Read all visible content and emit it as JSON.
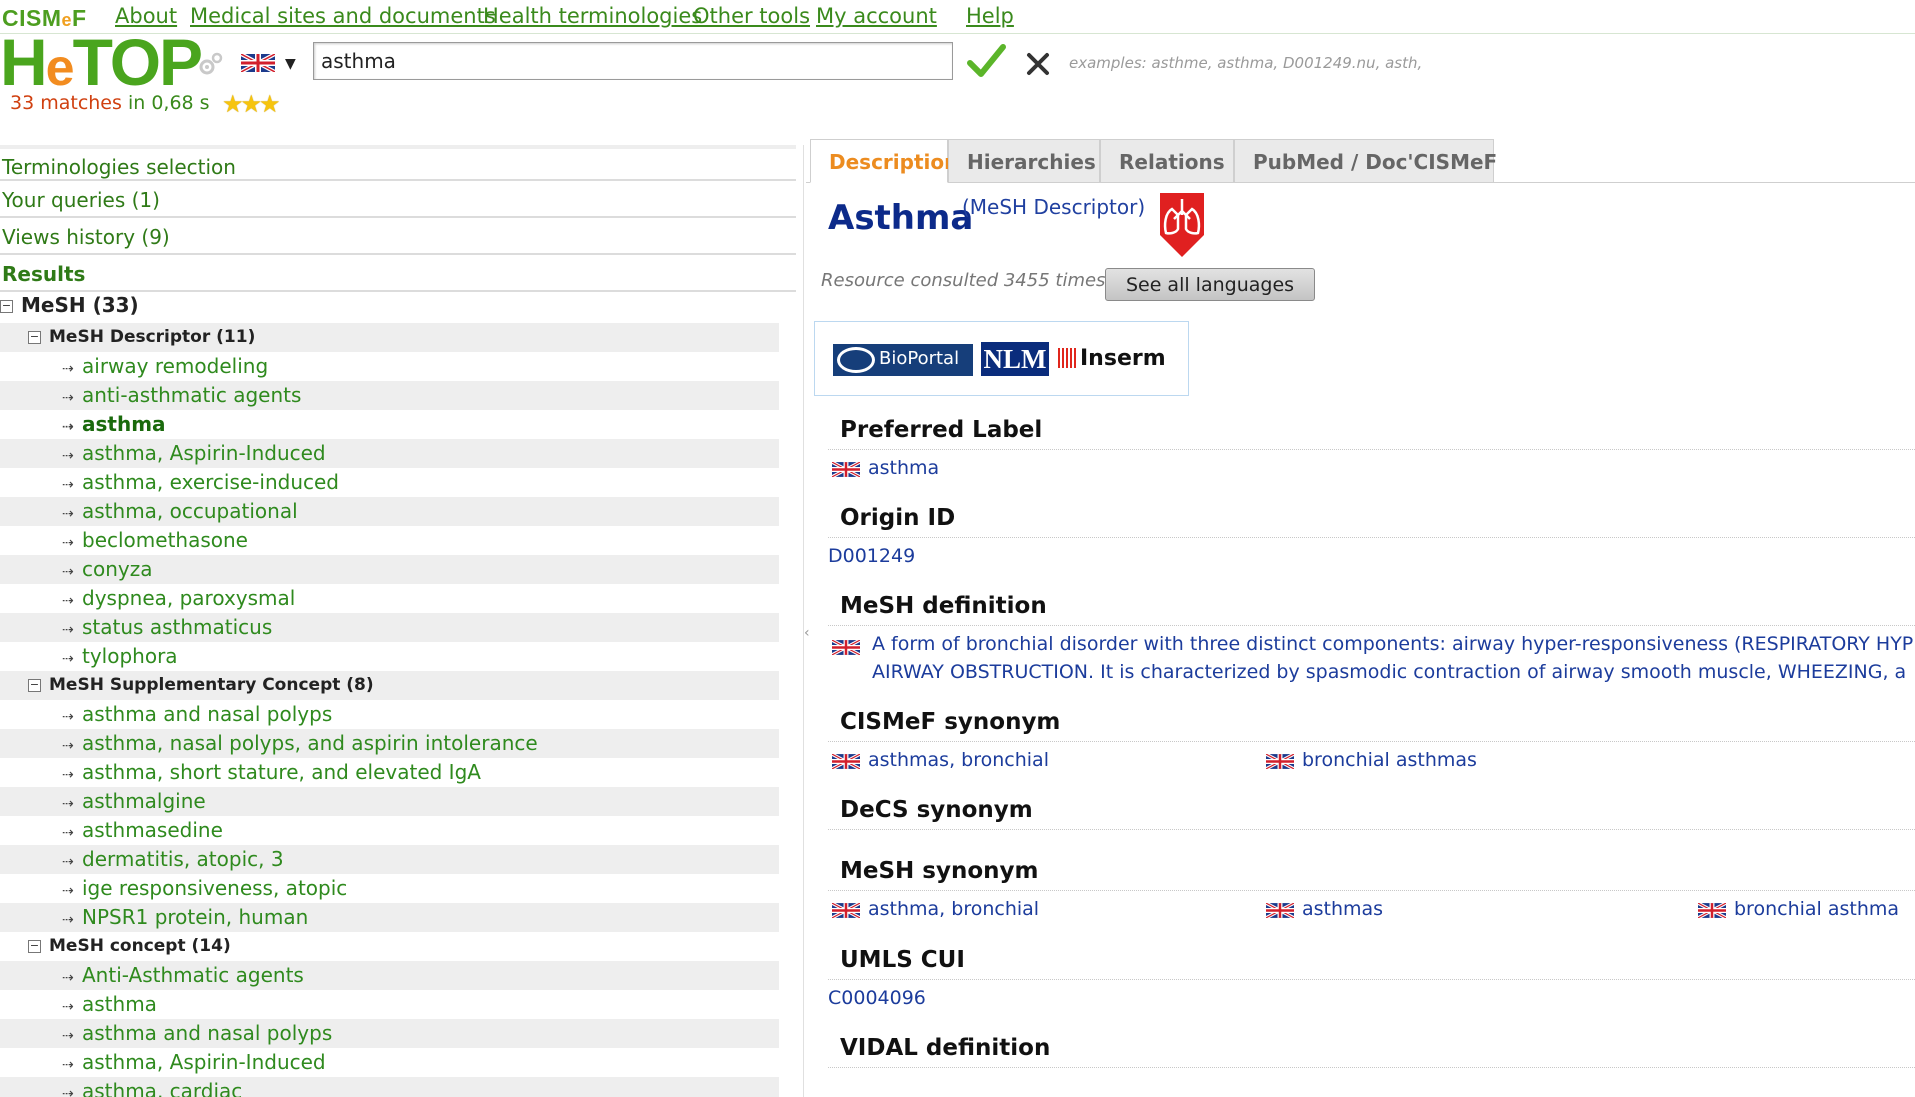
{
  "top_menu": {
    "logo": {
      "main": "CISM",
      "accent": "e",
      "tail": "F"
    },
    "items": [
      "About",
      "Medical sites and documents",
      "Health terminologies",
      "Other tools",
      "My account",
      "Help"
    ]
  },
  "header": {
    "logo": {
      "h": "H",
      "e": "e",
      "rest": "TOP"
    },
    "language_flag": "uk-flag-icon",
    "search_value": "asthma",
    "examples": "examples: asthme, asthma, D001249.nu, asth,",
    "matches": "33 matches",
    "time": "in 0,68 s",
    "stars": "★★★"
  },
  "left_panel": {
    "sections": [
      {
        "label": "Terminologies selection"
      },
      {
        "label": "Your queries (1)"
      },
      {
        "label": "Views history (9)"
      },
      {
        "label": "Results"
      }
    ],
    "tree": {
      "root": "MeSH (33)",
      "groups": [
        {
          "label": "MeSH Descriptor (11)",
          "items": [
            "airway remodeling",
            "anti-asthmatic agents",
            "asthma",
            "asthma, Aspirin-Induced",
            "asthma, exercise-induced",
            "asthma, occupational",
            "beclomethasone",
            "conyza",
            "dyspnea, paroxysmal",
            "status asthmaticus",
            "tylophora"
          ]
        },
        {
          "label": "MeSH Supplementary Concept (8)",
          "items": [
            "asthma and nasal polyps",
            "asthma, nasal polyps, and aspirin intolerance",
            "asthma, short stature, and elevated IgA",
            "asthmalgine",
            "asthmasedine",
            "dermatitis, atopic, 3",
            "ige responsiveness, atopic",
            "NPSR1 protein, human"
          ]
        },
        {
          "label": "MeSH concept (14)",
          "items": [
            "Anti-Asthmatic agents",
            "asthma",
            "asthma and nasal polyps",
            "asthma, Aspirin-Induced",
            "asthma, cardiac"
          ]
        }
      ]
    }
  },
  "right_panel": {
    "tabs": [
      "Description",
      "Hierarchies",
      "Relations",
      "PubMed / Doc'CISMeF"
    ],
    "active_tab": 0,
    "concept": {
      "title": "Asthma",
      "type": "(MeSH Descriptor)",
      "consulted": "Resource consulted 3455 times",
      "see_languages": "See all languages"
    },
    "external_logos": {
      "bioportal": "BioPortal",
      "nlm": "NLM",
      "inserm": "Inserm"
    },
    "fields": {
      "preferred_label": {
        "title": "Preferred Label",
        "value": "asthma"
      },
      "origin_id": {
        "title": "Origin ID",
        "value": "D001249"
      },
      "mesh_definition": {
        "title": "MeSH definition",
        "lines": [
          "A form of bronchial disorder with three distinct components: airway hyper-responsiveness (RESPIRATORY HYPE",
          "AIRWAY OBSTRUCTION. It is characterized by spasmodic contraction of airway smooth muscle, WHEEZING, a"
        ]
      },
      "cismef_synonym": {
        "title": "CISMeF synonym",
        "values": [
          "asthmas, bronchial",
          "bronchial asthmas"
        ]
      },
      "decs_synonym": {
        "title": "DeCS synonym"
      },
      "mesh_synonym": {
        "title": "MeSH synonym",
        "values": [
          "asthma, bronchial",
          "asthmas",
          "bronchial asthma"
        ]
      },
      "umls_cui": {
        "title": "UMLS CUI",
        "value": "C0004096"
      },
      "vidal_definition": {
        "title": "VIDAL definition"
      }
    }
  },
  "colors": {
    "link_green": "#2f8a1e",
    "accent_orange": "#ec8c20",
    "title_blue": "#0c2a8a",
    "value_blue": "#1c3c9c"
  }
}
